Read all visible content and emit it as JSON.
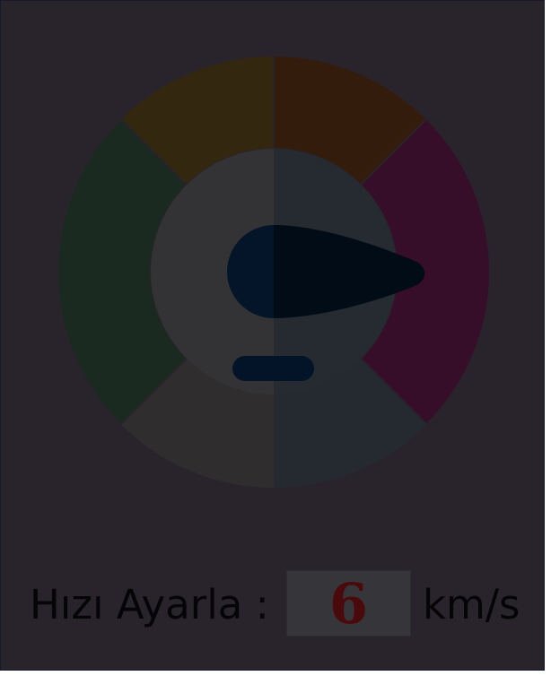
{
  "speed_control": {
    "label": "Hızı Ayarla :",
    "value": "6",
    "unit": "km/s"
  },
  "gauge": {
    "icon": "speedometer-icon",
    "colors": {
      "green_segment": "#1b2a20",
      "yellow_segment": "#33280f",
      "orange_segment": "#331c0c",
      "red_segment": "#360e2a",
      "bottom_left": "#2f2d2e",
      "bottom_right": "#252a30",
      "inner_left": "#333335",
      "inner_right": "#262b31",
      "needle": "#020c16",
      "pivot": "#041529"
    }
  },
  "colors": {
    "background": "#29242b",
    "text": "#050507",
    "value_text": "#4a0a0c",
    "value_box": "#36363a"
  }
}
